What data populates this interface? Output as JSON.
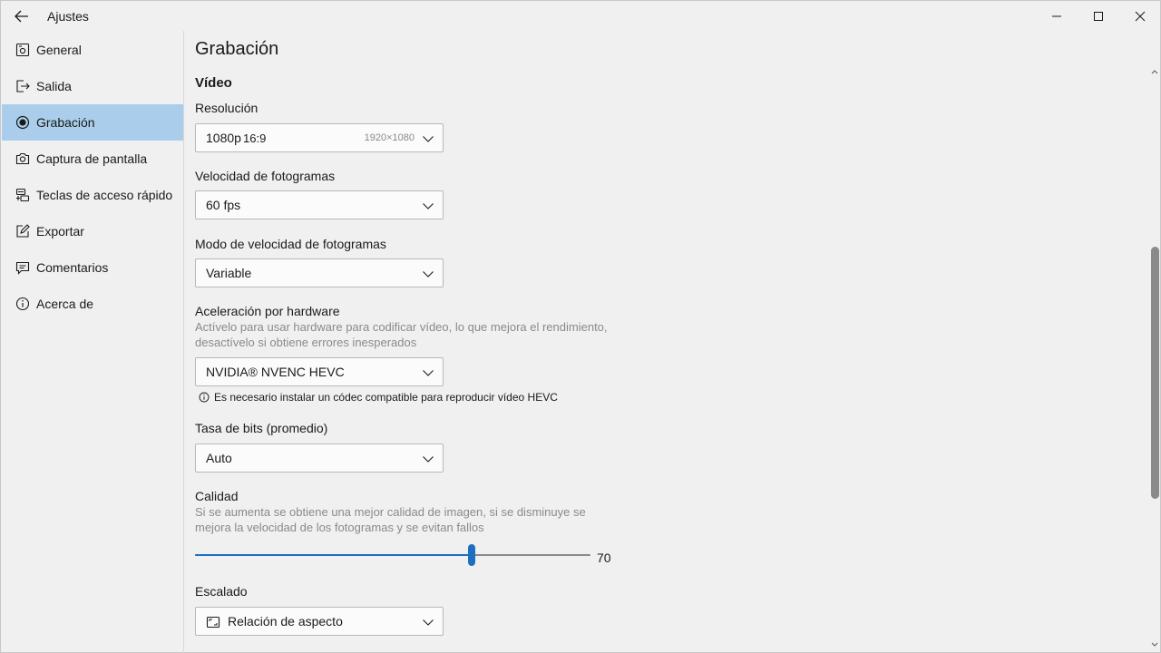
{
  "window": {
    "title": "Ajustes"
  },
  "sidebar": {
    "items": [
      {
        "label": "General",
        "icon": "gear-icon",
        "active": false
      },
      {
        "label": "Salida",
        "icon": "export-icon",
        "active": false
      },
      {
        "label": "Grabación",
        "icon": "record-icon",
        "active": true
      },
      {
        "label": "Captura de pantalla",
        "icon": "camera-icon",
        "active": false
      },
      {
        "label": "Teclas de acceso rápido",
        "icon": "keyboard-icon",
        "active": false
      },
      {
        "label": "Exportar",
        "icon": "edit-icon",
        "active": false
      },
      {
        "label": "Comentarios",
        "icon": "feedback-icon",
        "active": false
      },
      {
        "label": "Acerca de",
        "icon": "info-icon",
        "active": false
      }
    ]
  },
  "main": {
    "page_title": "Grabación",
    "section_title": "Vídeo",
    "resolution": {
      "label": "Resolución",
      "value": "1080p",
      "aspect": "16:9",
      "pixels": "1920×1080"
    },
    "framerate": {
      "label": "Velocidad de fotogramas",
      "value": "60 fps"
    },
    "framerate_mode": {
      "label": "Modo de velocidad de fotogramas",
      "value": "Variable"
    },
    "hw_accel": {
      "label": "Aceleración por hardware",
      "description": "Actívelo para usar hardware para codificar vídeo, lo que mejora el rendimiento, desactívelo si obtiene errores inesperados",
      "value": "NVIDIA® NVENC HEVC",
      "note": "Es necesario instalar un códec compatible para reproducir vídeo HEVC"
    },
    "bitrate": {
      "label": "Tasa de bits (promedio)",
      "value": "Auto"
    },
    "quality": {
      "label": "Calidad",
      "description": "Si se aumenta se obtiene una mejor calidad de imagen, si se disminuye se mejora la velocidad de los fotogramas y se evitan fallos",
      "value": 70,
      "value_text": "70",
      "fraction": 0.7
    },
    "scaling": {
      "label": "Escalado",
      "value": "Relación de aspecto"
    }
  },
  "colors": {
    "accent": "#1d6fc2",
    "active_nav": "#a9cdea",
    "background": "#f0f0f0"
  }
}
